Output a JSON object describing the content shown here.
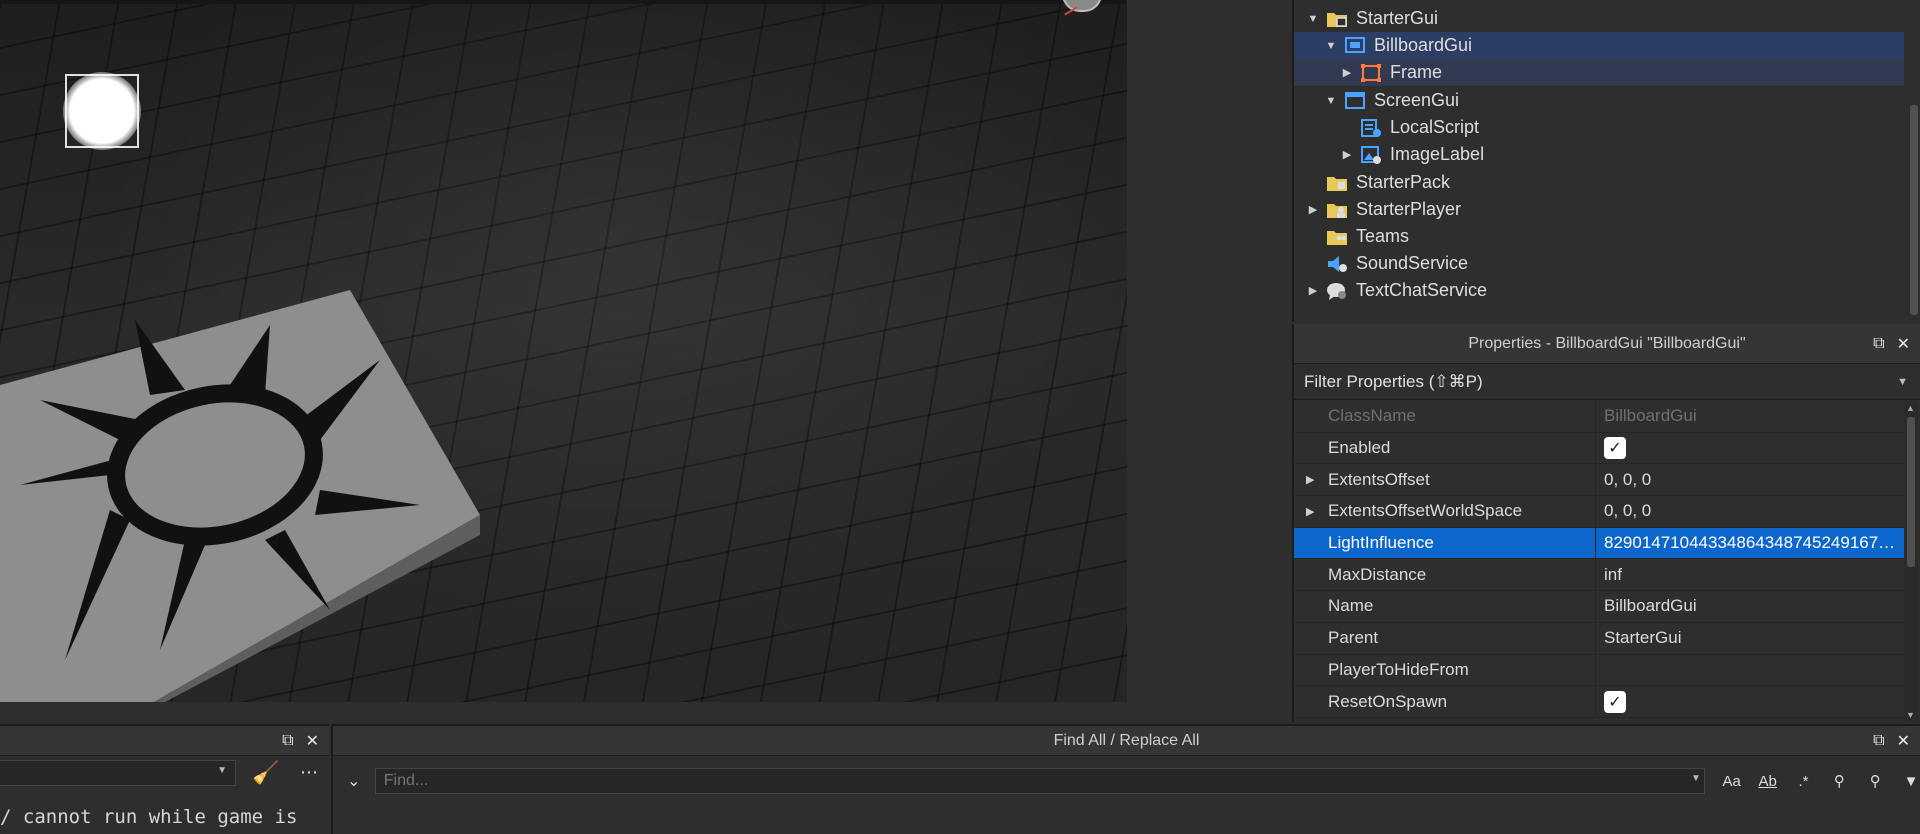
{
  "explorer": {
    "items": [
      {
        "label": "StarterGui",
        "icon": "folder-gui-icon",
        "expanded": true,
        "depth": 0
      },
      {
        "label": "BillboardGui",
        "icon": "billboard-gui-icon",
        "expanded": true,
        "depth": 1
      },
      {
        "label": "Frame",
        "icon": "frame-icon",
        "expanded": false,
        "depth": 2
      },
      {
        "label": "ScreenGui",
        "icon": "screen-gui-icon",
        "expanded": true,
        "depth": 1
      },
      {
        "label": "LocalScript",
        "icon": "local-script-icon",
        "depth": 2
      },
      {
        "label": "ImageLabel",
        "icon": "image-label-icon",
        "expanded": false,
        "depth": 2
      },
      {
        "label": "StarterPack",
        "icon": "folder-pack-icon",
        "depth": 0
      },
      {
        "label": "StarterPlayer",
        "icon": "folder-player-icon",
        "expanded": false,
        "depth": 0
      },
      {
        "label": "Teams",
        "icon": "folder-teams-icon",
        "depth": 0
      },
      {
        "label": "SoundService",
        "icon": "sound-service-icon",
        "depth": 0
      },
      {
        "label": "TextChatService",
        "icon": "text-chat-icon",
        "expanded": false,
        "depth": 0
      }
    ]
  },
  "properties": {
    "title": "Properties - BillboardGui \"BillboardGui\"",
    "filter_placeholder": "Filter Properties (⇧⌘P)",
    "rows": [
      {
        "name": "ClassName",
        "value": "BillboardGui"
      },
      {
        "name": "Enabled",
        "value": "",
        "checked": true
      },
      {
        "name": "ExtentsOffset",
        "value": "0, 0, 0"
      },
      {
        "name": "ExtentsOffsetWorldSpace",
        "value": "0, 0, 0"
      },
      {
        "name": "LightInfluence",
        "value": "82901471044334864348745249167…"
      },
      {
        "name": "MaxDistance",
        "value": "inf"
      },
      {
        "name": "Name",
        "value": "BillboardGui"
      },
      {
        "name": "Parent",
        "value": "StarterGui"
      },
      {
        "name": "PlayerToHideFrom",
        "value": ""
      },
      {
        "name": "ResetOnSpawn",
        "value": "",
        "checked": true
      }
    ]
  },
  "output": {
    "text": "/ cannot run while game is"
  },
  "find": {
    "title": "Find All / Replace All",
    "placeholder": "Find...",
    "options": {
      "match_case": "Aa",
      "whole_word": "Ab",
      "regex": ".*"
    }
  },
  "colors": {
    "selection": "#2c3e63",
    "highlight": "#0c66cc",
    "panel_bg": "#2e2e2e"
  }
}
